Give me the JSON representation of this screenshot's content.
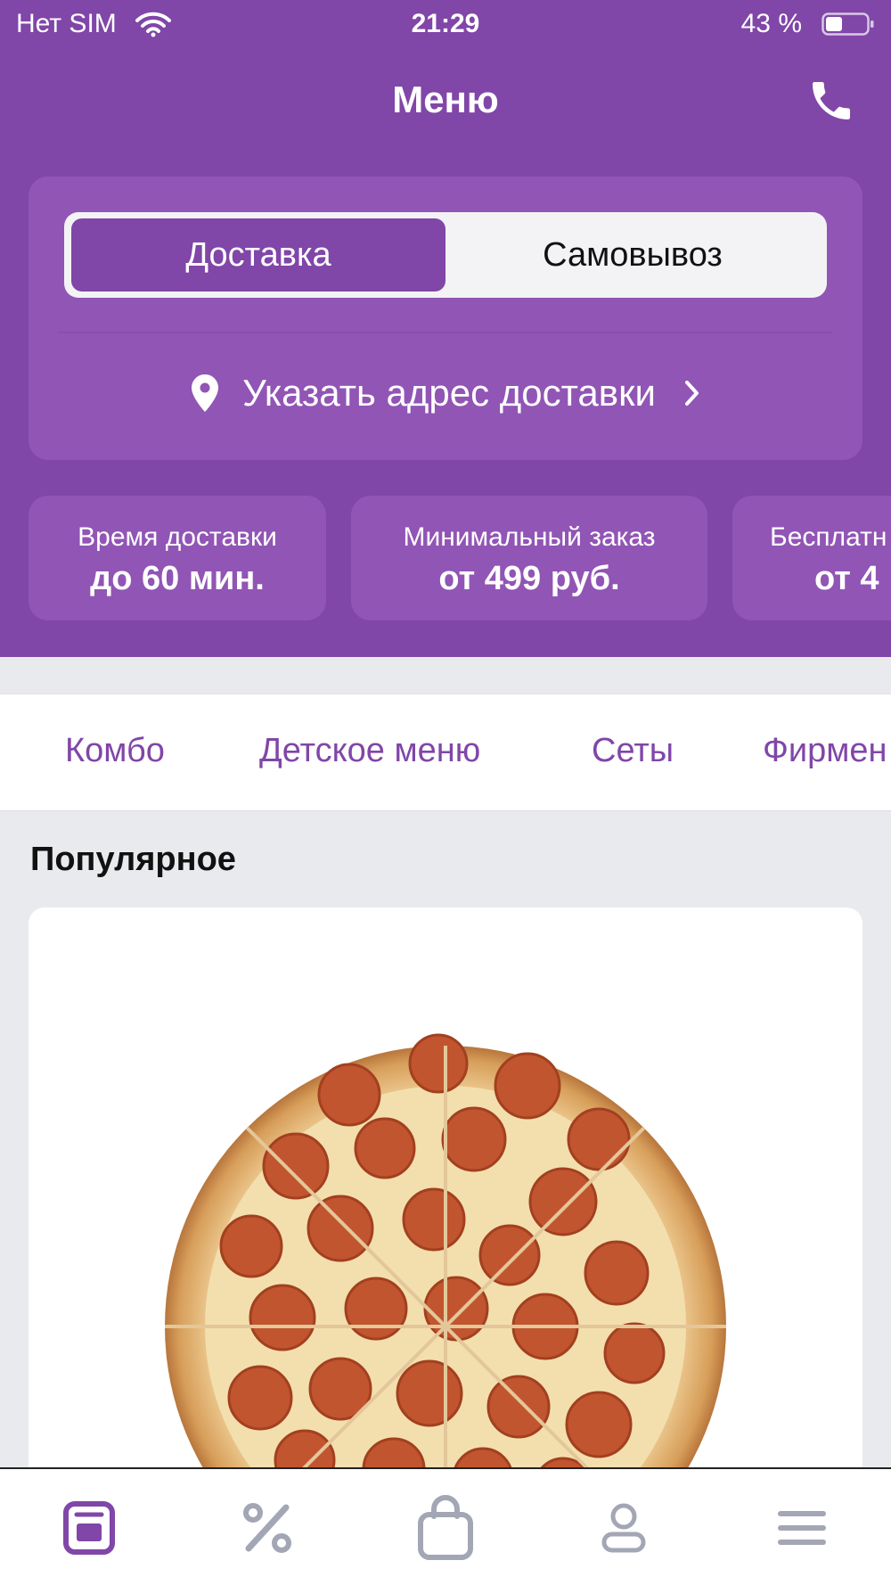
{
  "status_bar": {
    "carrier": "Нет SIM",
    "time": "21:29",
    "battery": "43 %"
  },
  "nav": {
    "title": "Меню"
  },
  "delivery_mode": {
    "options": [
      "Доставка",
      "Самовывоз"
    ],
    "selected": "Доставка"
  },
  "address": {
    "label": "Указать адрес доставки"
  },
  "info_chips": [
    {
      "label": "Время доставки",
      "value": "до 60 мин."
    },
    {
      "label": "Минимальный заказ",
      "value": "от 499 руб."
    },
    {
      "label": "Бесплатн",
      "value": "от 4"
    }
  ],
  "categories": [
    "Комбо",
    "Детское меню",
    "Сеты",
    "Фирмен"
  ],
  "section": {
    "title": "Популярное"
  },
  "tabs": [
    {
      "icon": "menu-icon",
      "active": true
    },
    {
      "icon": "percent-icon",
      "active": false
    },
    {
      "icon": "bag-icon",
      "active": false
    },
    {
      "icon": "profile-icon",
      "active": false
    },
    {
      "icon": "hamburger-icon",
      "active": false
    }
  ],
  "colors": {
    "brand": "#8046a8",
    "brand_light": "#9155b5",
    "tab_inactive": "#a3a6b4"
  }
}
